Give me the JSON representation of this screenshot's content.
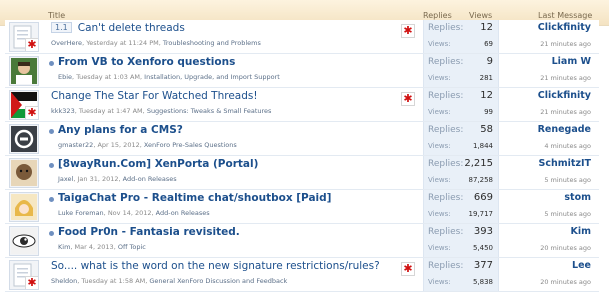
{
  "columns": {
    "title": "Title",
    "replies": "Replies",
    "views": "Views",
    "last_message": "Last Message"
  },
  "threads": [
    {
      "title": "Can't delete threads",
      "page_jump": "1.1",
      "bold": false,
      "sticky": true,
      "avatar_star": true,
      "author": "OverHere",
      "date": "Yesterday at 11:24 PM",
      "forum": "Troubleshooting and Problems",
      "replies_label": "Replies:",
      "replies": "12",
      "views_label": "Views:",
      "views": "69",
      "last_user": "Clickfinity",
      "last_time": "21 minutes ago"
    },
    {
      "title": "From VB to Xenforo questions",
      "page_jump": "",
      "bold": true,
      "sticky": false,
      "avatar_star": false,
      "author": "Ebie",
      "date": "Tuesday at 1:03 AM",
      "forum": "Installation, Upgrade, and Import Support",
      "replies_label": "Replies:",
      "replies": "9",
      "views_label": "Views:",
      "views": "281",
      "last_user": "Liam W",
      "last_time": "21 minutes ago"
    },
    {
      "title": "Change The Star For Watched Threads!",
      "page_jump": "",
      "bold": false,
      "sticky": true,
      "avatar_star": true,
      "author": "kkk323",
      "date": "Tuesday at 1:47 AM",
      "forum": "Suggestions: Tweaks & Small Features",
      "replies_label": "Replies:",
      "replies": "12",
      "views_label": "Views:",
      "views": "99",
      "last_user": "Clickfinity",
      "last_time": "21 minutes ago"
    },
    {
      "title": "Any plans for a CMS?",
      "page_jump": "",
      "bold": true,
      "sticky": false,
      "avatar_star": false,
      "author": "gmaster22",
      "date": "Apr 15, 2012",
      "forum": "XenForo Pre-Sales Questions",
      "replies_label": "Replies:",
      "replies": "58",
      "views_label": "Views:",
      "views": "1,844",
      "last_user": "Renegade",
      "last_time": "4 minutes ago"
    },
    {
      "title": "[8wayRun.Com] XenPorta (Portal)",
      "page_jump": "",
      "bold": true,
      "sticky": false,
      "avatar_star": false,
      "author": "Jaxel",
      "date": "Jan 31, 2012",
      "forum": "Add-on Releases",
      "replies_label": "Replies:",
      "replies": "2,215",
      "views_label": "Views:",
      "views": "87,258",
      "last_user": "SchmitzIT",
      "last_time": "5 minutes ago"
    },
    {
      "title": "TaigaChat Pro - Realtime chat/shoutbox [Paid]",
      "page_jump": "",
      "bold": true,
      "sticky": false,
      "avatar_star": false,
      "author": "Luke Foreman",
      "date": "Nov 14, 2012",
      "forum": "Add-on Releases",
      "replies_label": "Replies:",
      "replies": "669",
      "views_label": "Views:",
      "views": "19,717",
      "last_user": "stom",
      "last_time": "5 minutes ago"
    },
    {
      "title": "Food Pr0n - Fantasia revisited.",
      "page_jump": "",
      "bold": true,
      "sticky": false,
      "avatar_star": false,
      "author": "Kim",
      "date": "Mar 4, 2013",
      "forum": "Off Topic",
      "replies_label": "Replies:",
      "replies": "393",
      "views_label": "Views:",
      "views": "5,450",
      "last_user": "Kim",
      "last_time": "20 minutes ago"
    },
    {
      "title": "So.... what is the word on the new signature restrictions/rules?",
      "page_jump": "",
      "bold": false,
      "sticky": true,
      "avatar_star": true,
      "author": "Sheldon",
      "date": "Tuesday at 1:58 AM",
      "forum": "General XenForo Discussion and Feedback",
      "replies_label": "Replies:",
      "replies": "377",
      "views_label": "Views:",
      "views": "5,838",
      "last_user": "Lee",
      "last_time": "20 minutes ago"
    }
  ],
  "avatar_icons": [
    "doc-avatar-icon",
    "person-avatar-icon",
    "flag-avatar-icon",
    "logo-avatar-icon",
    "face-avatar-icon",
    "anime-avatar-icon",
    "eye-avatar-icon",
    "doc-avatar-icon"
  ],
  "colors": {
    "header_bg": "#f4e3c2",
    "link": "#1c4f8c",
    "stats_bg": "#e9f0f8",
    "star": "#d01010"
  }
}
